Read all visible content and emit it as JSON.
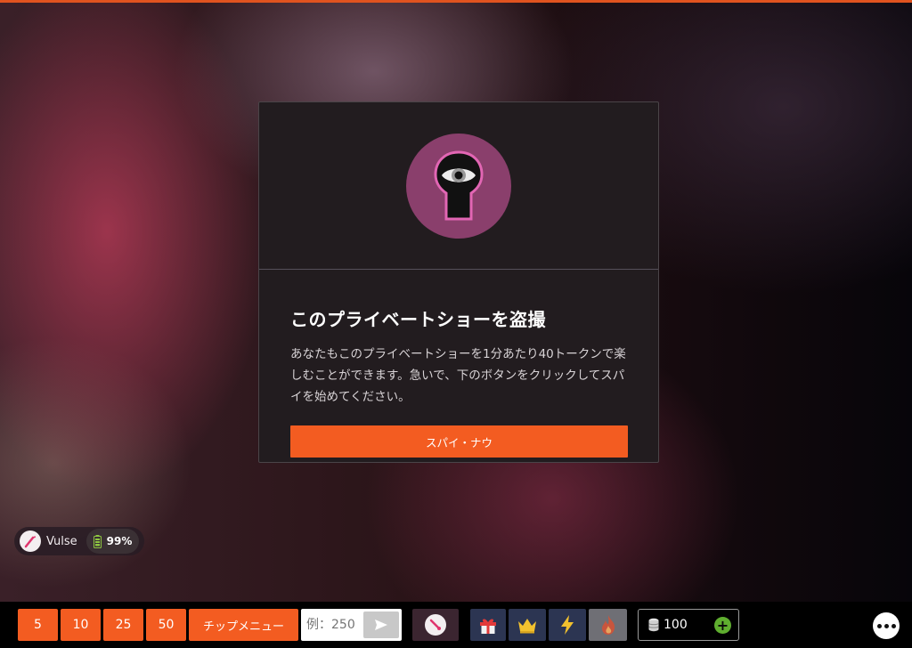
{
  "modal": {
    "title": "このプライベートショーを盗撮",
    "description": "あなたもこのプライベートショーを1分あたり40トークンで楽しむことができます。急いで、下のボタンをクリックしてスパイを始めてください。",
    "button_label": "スパイ・ナウ",
    "hero_icon": "keyhole-eye-icon",
    "hero_color": "#8a3f6c"
  },
  "device": {
    "name": "Vulse",
    "battery": "99%"
  },
  "tip_bar": {
    "quick_tips": [
      "5",
      "10",
      "25",
      "50"
    ],
    "tip_menu_label": "チップメニュー",
    "tip_input_placeholder": "例：250",
    "send_icon": "send-icon",
    "accent": "#f35c21"
  },
  "tokens": {
    "balance": "100"
  }
}
